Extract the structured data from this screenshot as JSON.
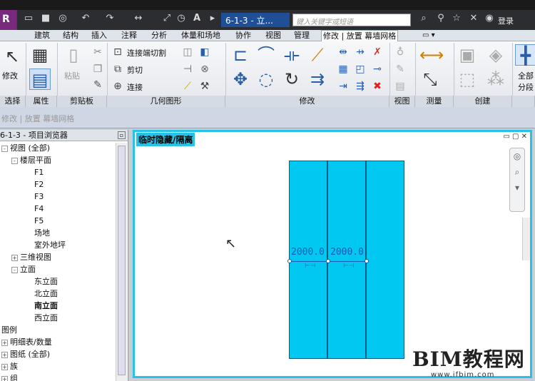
{
  "window": {
    "doc_tab": "6-1-3 - 立...",
    "search_placeholder": "键入关键字或短语",
    "login_label": "登录"
  },
  "ribbon_tabs": [
    "建筑",
    "结构",
    "插入",
    "注释",
    "分析",
    "体量和场地",
    "协作",
    "视图",
    "管理",
    "修改 | 放置 幕墙网格"
  ],
  "ribbon": {
    "modify_label": "修改",
    "paste_label": "粘贴",
    "join_cut": "连接端切割",
    "cut": "剪切",
    "join": "连接",
    "all_segments": "全部",
    "segments": "分段"
  },
  "panels": [
    "选择",
    "属性",
    "剪贴板",
    "几何图形",
    "修改",
    "视图",
    "测量",
    "创建"
  ],
  "options_bar": {
    "text": "修改 | 放置 幕墙网格"
  },
  "browser": {
    "title": "6-1-3 - 项目浏览器",
    "items": [
      {
        "label": "视图 (全部)",
        "level": 0,
        "toggle": "-"
      },
      {
        "label": "楼层平面",
        "level": 1,
        "toggle": "-"
      },
      {
        "label": "F1",
        "level": 2
      },
      {
        "label": "F2",
        "level": 2
      },
      {
        "label": "F3",
        "level": 2
      },
      {
        "label": "F4",
        "level": 2
      },
      {
        "label": "F5",
        "level": 2
      },
      {
        "label": "场地",
        "level": 2
      },
      {
        "label": "室外地坪",
        "level": 2
      },
      {
        "label": "三维视图",
        "level": 1,
        "toggle": "+"
      },
      {
        "label": "立面",
        "level": 1,
        "toggle": "-"
      },
      {
        "label": "东立面",
        "level": 2
      },
      {
        "label": "北立面",
        "level": 2
      },
      {
        "label": "南立面",
        "level": 2,
        "selected": true
      },
      {
        "label": "西立面",
        "level": 2
      },
      {
        "label": "图例",
        "level": 0
      },
      {
        "label": "明细表/数量",
        "level": 0,
        "toggle": "+"
      },
      {
        "label": "图纸 (全部)",
        "level": 0,
        "toggle": "+"
      },
      {
        "label": "族",
        "level": 0,
        "toggle": "+"
      },
      {
        "label": "组",
        "level": 0,
        "toggle": "+"
      }
    ]
  },
  "canvas": {
    "temp_label": "临时隐藏/隔离",
    "dim1": "2000.0",
    "dim2": "2000.0"
  },
  "watermark": {
    "big": "BIM教程网",
    "small": "www.ifbim.com"
  },
  "colors": {
    "accent": "#26c3e6",
    "panel_fill": "#00c8f0",
    "dimension": "#1a5ab8"
  }
}
